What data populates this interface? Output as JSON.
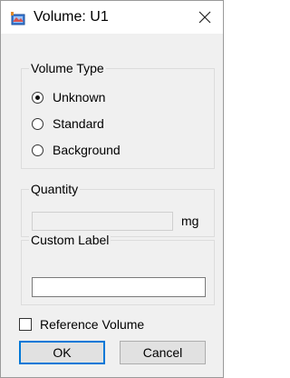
{
  "window": {
    "title": "Volume: U1",
    "app_icon": "volume-app-icon",
    "close_icon": "close-icon"
  },
  "volume_type": {
    "legend": "Volume Type",
    "options": [
      {
        "label": "Unknown",
        "checked": true
      },
      {
        "label": "Standard",
        "checked": false
      },
      {
        "label": "Background",
        "checked": false
      }
    ]
  },
  "quantity": {
    "legend": "Quantity",
    "value": "",
    "unit": "mg"
  },
  "custom_label": {
    "legend": "Custom Label",
    "value": ""
  },
  "reference_volume": {
    "label": "Reference Volume",
    "checked": false
  },
  "buttons": {
    "ok": "OK",
    "cancel": "Cancel"
  },
  "colors": {
    "default_button_border": "#0078d7",
    "dialog_background": "#f0f0f0"
  }
}
